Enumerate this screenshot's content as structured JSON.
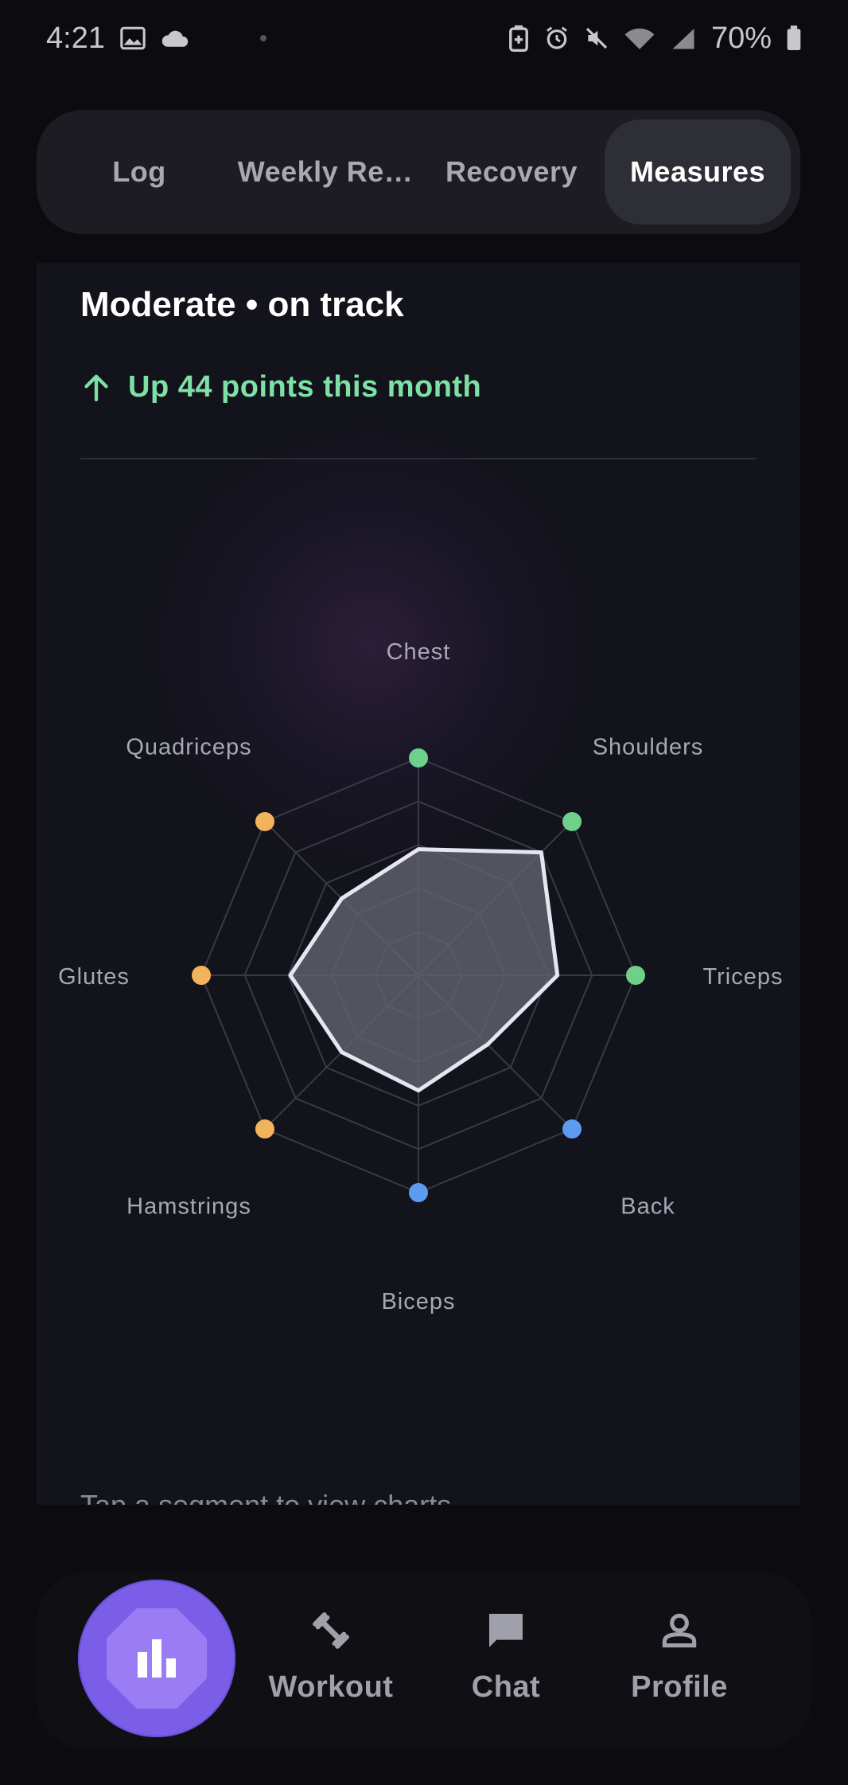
{
  "status_bar": {
    "time": "4:21",
    "battery": "70%",
    "icons": [
      "image-icon",
      "cloud-icon",
      "battery-saver-icon",
      "alarm-icon",
      "mute-icon",
      "wifi-icon",
      "signal-icon",
      "battery-icon"
    ]
  },
  "tabs": [
    {
      "label": "Log",
      "active": false
    },
    {
      "label": "Weekly Re…",
      "active": false
    },
    {
      "label": "Recovery",
      "active": false
    },
    {
      "label": "Measures",
      "active": true
    }
  ],
  "summary": {
    "status": "Moderate • on track",
    "trend": "Up 44 points this month",
    "trend_icon": "arrow-up-icon",
    "trend_color": "#7ee0a6"
  },
  "chart_data": {
    "type": "radar",
    "axes": [
      "Chest",
      "Shoulders",
      "Triceps",
      "Back",
      "Biceps",
      "Hamstrings",
      "Glutes",
      "Quadriceps"
    ],
    "values": [
      0.58,
      0.8,
      0.64,
      0.45,
      0.53,
      0.5,
      0.59,
      0.5
    ],
    "range": [
      0,
      1
    ],
    "rings": 5,
    "marker_colors": [
      "#6fd08c",
      "#6fd08c",
      "#6fd08c",
      "#5b9cf0",
      "#5b9cf0",
      "#f2b45a",
      "#f2b45a",
      "#f2b45a"
    ],
    "fill_color": "#62626e",
    "outline_color": "#e6e6f0"
  },
  "hint": "Tap a segment to view charts",
  "bottom_nav": {
    "items": [
      {
        "label": "",
        "icon": "bar-chart-icon",
        "active": true
      },
      {
        "label": "Workout",
        "icon": "dumbbell-icon",
        "active": false
      },
      {
        "label": "Chat",
        "icon": "chat-bubble-icon",
        "active": false
      },
      {
        "label": "Profile",
        "icon": "person-icon",
        "active": false
      }
    ],
    "accent": "#7b5ee8"
  }
}
